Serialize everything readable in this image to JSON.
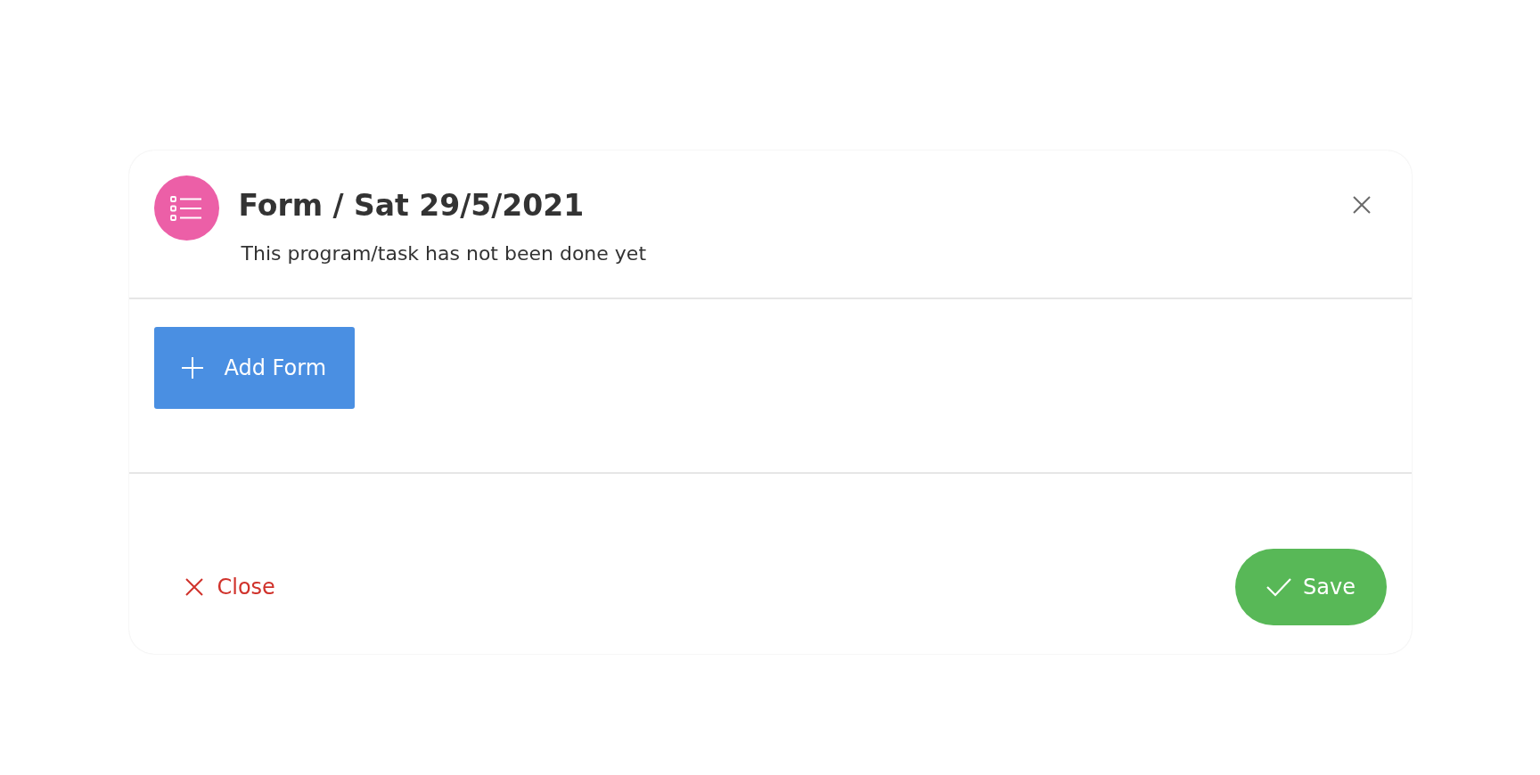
{
  "dialog": {
    "title": "Form / Sat 29/5/2021",
    "subtitle": "This program/task has not been done yet"
  },
  "add_button": {
    "label": "Add Form"
  },
  "footer": {
    "close_label": "Close",
    "save_label": "Save"
  }
}
